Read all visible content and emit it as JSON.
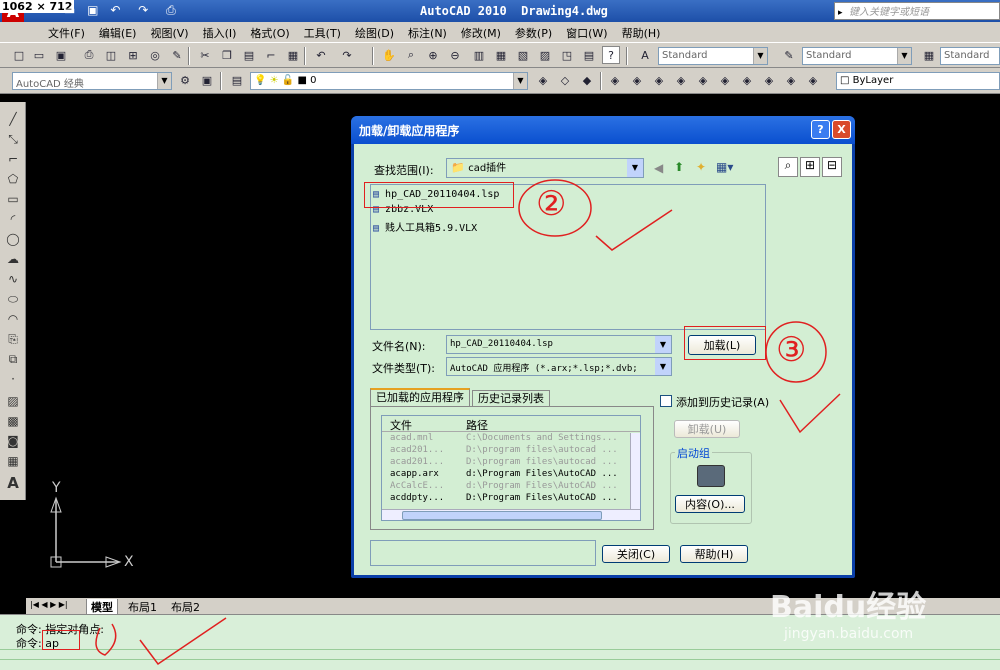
{
  "screen_size_label": "1062 × 712",
  "app_title": "AutoCAD 2010  Drawing4.dwg",
  "search_placeholder": "键入关键字或短语",
  "menu": [
    "文件(F)",
    "编辑(E)",
    "视图(V)",
    "插入(I)",
    "格式(O)",
    "工具(T)",
    "绘图(D)",
    "标注(N)",
    "修改(M)",
    "参数(P)",
    "窗口(W)",
    "帮助(H)"
  ],
  "toolbar": {
    "style1": "Standard",
    "style2": "Standard",
    "style3": "Standard",
    "workspace": "AutoCAD 经典",
    "layer": "0",
    "bylayer": "ByLayer"
  },
  "dialog": {
    "title": "加载/卸载应用程序",
    "help_btn": "?",
    "close_btn": "X",
    "lookin_label": "查找范围(I):",
    "lookin_value": "cad插件",
    "files": [
      {
        "name": "hp_CAD_20110404.lsp",
        "icon": "lsp-file-icon"
      },
      {
        "name": "zbbz.VLX",
        "icon": "vlx-file-icon"
      },
      {
        "name": "贱人工具箱5.9.VLX",
        "icon": "vlx-file-icon"
      }
    ],
    "filename_label": "文件名(N):",
    "filename_value": "hp_CAD_20110404.lsp",
    "filetype_label": "文件类型(T):",
    "filetype_value": "AutoCAD 应用程序 (*.arx;*.lsp;*.dvb;",
    "load_btn": "加载(L)",
    "tab_loaded": "已加载的应用程序",
    "tab_history": "历史记录列表",
    "add_history": "添加到历史记录(A)",
    "unload_btn": "卸载(U)",
    "startup_group": "启动组",
    "contents_btn": "内容(O)...",
    "close_dialog_btn": "关闭(C)",
    "help_dialog_btn": "帮助(H)",
    "col_file": "文件",
    "col_path": "路径",
    "loaded_apps": [
      {
        "file": "acad.mnl",
        "path": "C:\\Documents and Settings...",
        "gray": true
      },
      {
        "file": "acad201...",
        "path": "D:\\program files\\autocad ...",
        "gray": true
      },
      {
        "file": "acad201...",
        "path": "D:\\program files\\autocad ...",
        "gray": true
      },
      {
        "file": "acapp.arx",
        "path": "d:\\Program Files\\AutoCAD ...",
        "gray": false
      },
      {
        "file": "AcCalcE...",
        "path": "d:\\Program Files\\AutoCAD ...",
        "gray": true
      },
      {
        "file": "acddpty...",
        "path": "D:\\Program Files\\AutoCAD ...",
        "gray": false
      }
    ]
  },
  "layout_tabs": [
    "模型",
    "布局1",
    "布局2"
  ],
  "command_lines": [
    "命令: 指定对角点:",
    "命令: ap"
  ],
  "ucs": {
    "x": "X",
    "y": "Y"
  },
  "annotations": [
    "②",
    "③"
  ],
  "watermark": {
    "brand": "Baidu经验",
    "url": "jingyan.baidu.com"
  }
}
